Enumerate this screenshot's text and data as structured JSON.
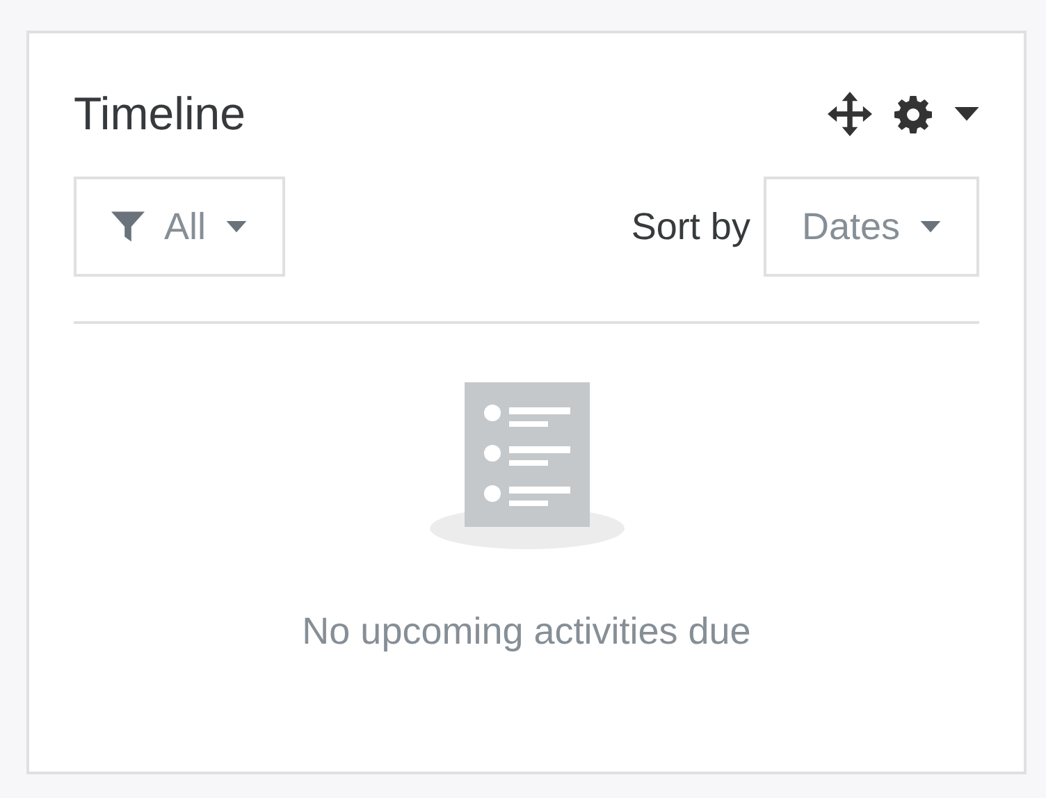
{
  "block": {
    "title": "Timeline"
  },
  "filter": {
    "label": "All"
  },
  "sort": {
    "label": "Sort by",
    "value": "Dates"
  },
  "empty_state": {
    "message": "No upcoming activities due"
  }
}
